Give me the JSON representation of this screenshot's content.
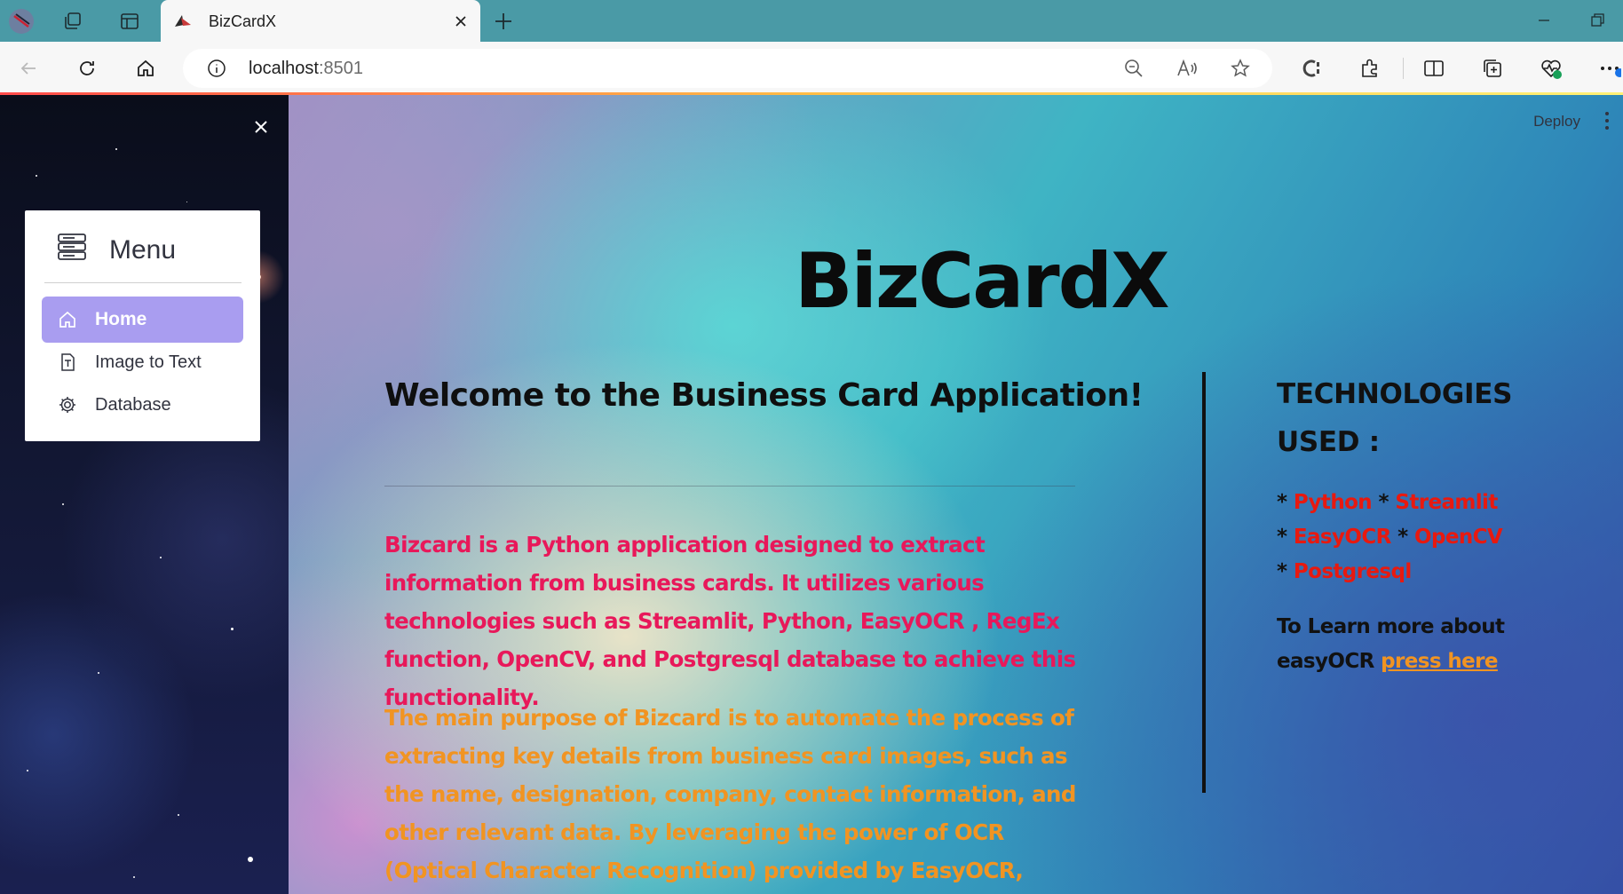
{
  "browser": {
    "tab_title": "BizCardX",
    "url_host": "localhost",
    "url_port": ":8501"
  },
  "sidebar": {
    "menu_title": "Menu",
    "items": [
      {
        "label": "Home",
        "icon": "house-icon",
        "active": true
      },
      {
        "label": "Image to Text",
        "icon": "text-file-icon",
        "active": false
      },
      {
        "label": "Database",
        "icon": "gear-icon",
        "active": false
      }
    ],
    "accent_color": "#a99df0"
  },
  "header": {
    "deploy_label": "Deploy"
  },
  "main": {
    "title": "BizCardX",
    "welcome": "Welcome to the Business Card Application!",
    "para1": "Bizcard is a Python application designed to extract information from business cards. It utilizes various technologies such as Streamlit, Python, EasyOCR , RegEx function, OpenCV, and Postgresql database to achieve this functionality.",
    "para2": "The main purpose of Bizcard is to automate the process of extracting key details from business card images, such as the name, designation, company, contact information, and other relevant data. By leveraging the power of OCR (Optical Character Recognition) provided by EasyOCR, Bizcard is able to extract text from the images.",
    "para1_color": "#e8185a",
    "para2_color": "#f19422"
  },
  "tech": {
    "heading": "TECHNOLOGIES USED :",
    "bullet": "*",
    "items": [
      "Python",
      "Streamlit",
      "EasyOCR",
      "OpenCV",
      "Postgresql"
    ],
    "learn_text": "To Learn more about easyOCR",
    "learn_link": "press here"
  }
}
